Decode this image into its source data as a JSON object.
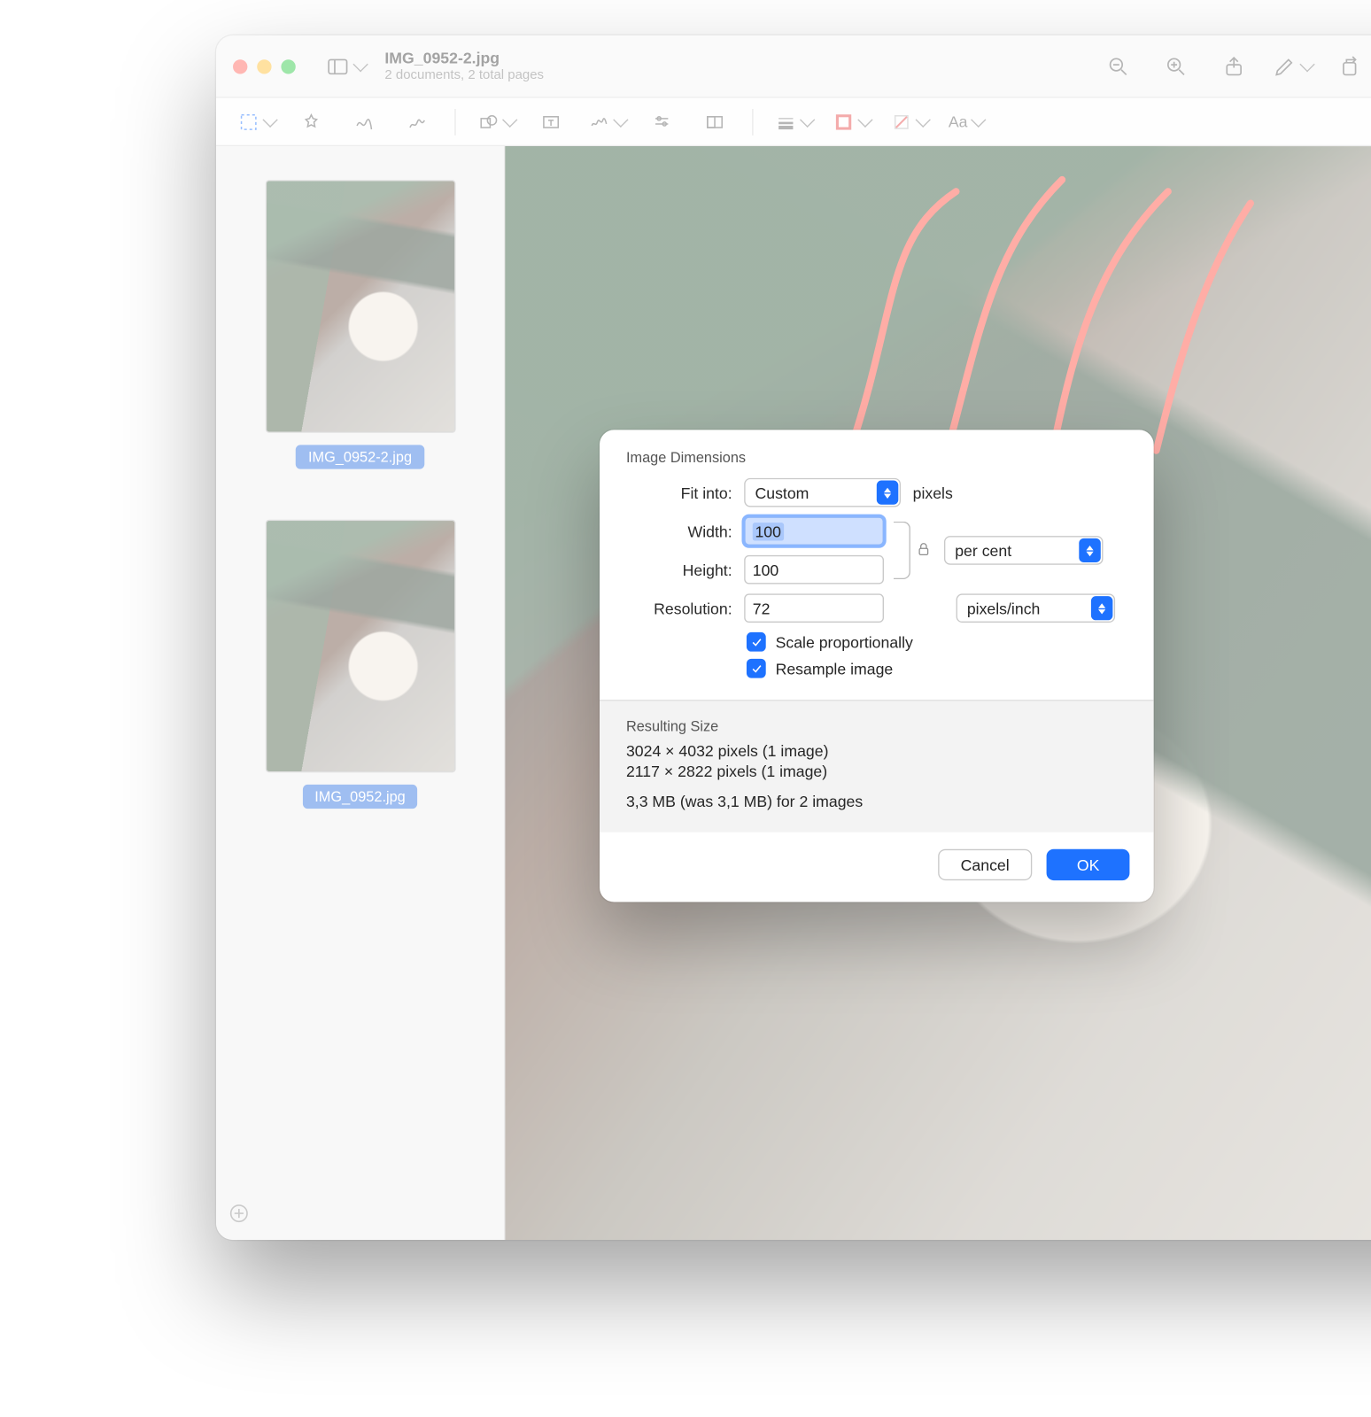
{
  "window": {
    "title": "IMG_0952-2.jpg",
    "subtitle": "2 documents, 2 total pages"
  },
  "sidebar": {
    "thumbs": [
      {
        "label": "IMG_0952-2.jpg"
      },
      {
        "label": "IMG_0952.jpg"
      }
    ]
  },
  "dialog": {
    "section_label": "Image Dimensions",
    "fit_into_label": "Fit into:",
    "fit_into_value": "Custom",
    "fit_into_unit": "pixels",
    "width_label": "Width:",
    "width_value": "100",
    "height_label": "Height:",
    "height_value": "100",
    "wh_unit": "per cent",
    "resolution_label": "Resolution:",
    "resolution_value": "72",
    "resolution_unit": "pixels/inch",
    "scale_label": "Scale proportionally",
    "resample_label": "Resample image",
    "resulting_label": "Resulting Size",
    "result_line1": "3024 × 4032 pixels (1 image)",
    "result_line2": "2117 × 2822 pixels (1 image)",
    "result_line3": "3,3 MB (was 3,1 MB) for 2 images",
    "cancel": "Cancel",
    "ok": "OK"
  }
}
